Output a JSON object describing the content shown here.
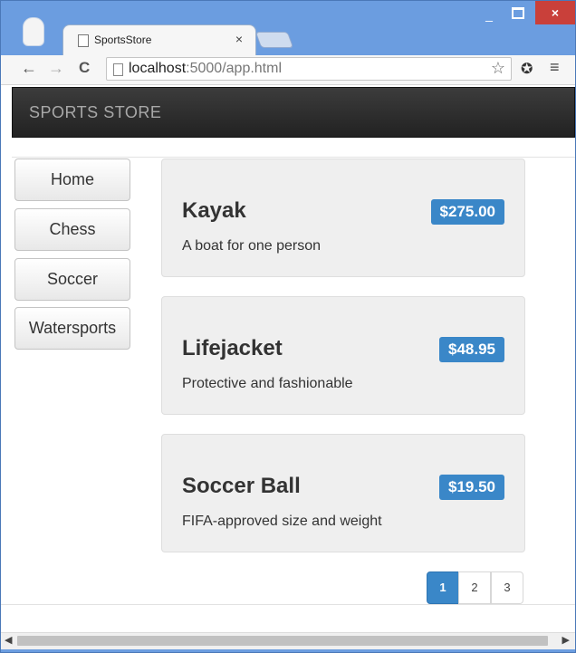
{
  "browser": {
    "tab_title": "SportsStore",
    "tab_close": "×",
    "url_host": "localhost",
    "url_rest": ":5000/app.html",
    "back": "←",
    "forward": "→",
    "reload": "C",
    "star": "☆",
    "menu": "≡",
    "minimize": "_",
    "close": "×"
  },
  "navbar": {
    "brand": "SPORTS STORE"
  },
  "categories": [
    {
      "label": "Home"
    },
    {
      "label": "Chess"
    },
    {
      "label": "Soccer"
    },
    {
      "label": "Watersports"
    }
  ],
  "products": [
    {
      "name": "Kayak",
      "price": "$275.00",
      "description": "A boat for one person"
    },
    {
      "name": "Lifejacket",
      "price": "$48.95",
      "description": "Protective and fashionable"
    },
    {
      "name": "Soccer Ball",
      "price": "$19.50",
      "description": "FIFA-approved size and weight"
    }
  ],
  "pagination": {
    "pages": [
      "1",
      "2",
      "3"
    ],
    "active": "1"
  },
  "colors": {
    "accent": "#3a87c8",
    "navbar": "#2b2b2b",
    "titlebar": "#6b9de0",
    "close": "#c9403a"
  }
}
